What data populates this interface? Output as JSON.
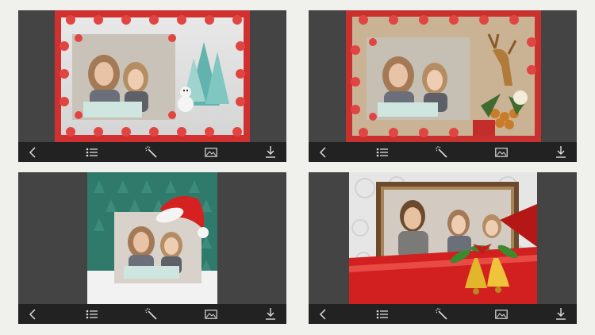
{
  "app": {
    "background_color": "#f0f0ec",
    "toolbar_color": "#222222",
    "viewer_color": "#444444"
  },
  "toolbar_icons": [
    {
      "name": "back-chevron-icon"
    },
    {
      "name": "list-menu-icon"
    },
    {
      "name": "magic-wand-icon"
    },
    {
      "name": "image-gallery-icon"
    },
    {
      "name": "download-icon"
    }
  ],
  "frames": [
    {
      "name": "snowy-tree-frame",
      "theme": "white snow with red bows and teal christmas trees",
      "accent": "#d0302f"
    },
    {
      "name": "reindeer-ornament-frame",
      "theme": "beige wood with red bows, reindeer and gold ornaments",
      "accent": "#c8312d"
    },
    {
      "name": "santa-hat-frame",
      "theme": "green tree pattern with santa hat",
      "accent": "#2f7a6a"
    },
    {
      "name": "golden-bells-frame",
      "theme": "silver swirl with red ribbon and golden bells",
      "accent": "#d21f1f"
    }
  ]
}
